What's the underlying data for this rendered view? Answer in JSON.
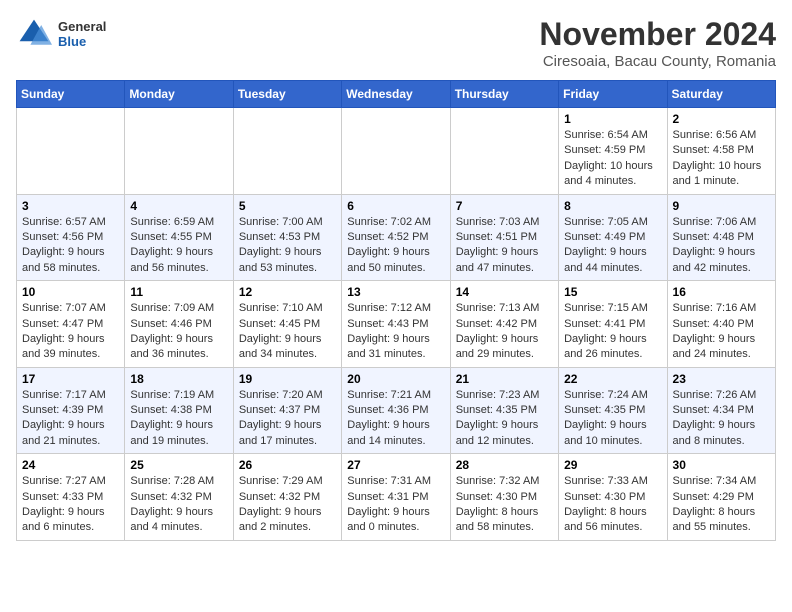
{
  "header": {
    "logo": {
      "general": "General",
      "blue": "Blue"
    },
    "title": "November 2024",
    "subtitle": "Ciresoaia, Bacau County, Romania"
  },
  "calendar": {
    "weekdays": [
      "Sunday",
      "Monday",
      "Tuesday",
      "Wednesday",
      "Thursday",
      "Friday",
      "Saturday"
    ],
    "weeks": [
      [
        {
          "day": "",
          "info": ""
        },
        {
          "day": "",
          "info": ""
        },
        {
          "day": "",
          "info": ""
        },
        {
          "day": "",
          "info": ""
        },
        {
          "day": "",
          "info": ""
        },
        {
          "day": "1",
          "info": "Sunrise: 6:54 AM\nSunset: 4:59 PM\nDaylight: 10 hours and 4 minutes."
        },
        {
          "day": "2",
          "info": "Sunrise: 6:56 AM\nSunset: 4:58 PM\nDaylight: 10 hours and 1 minute."
        }
      ],
      [
        {
          "day": "3",
          "info": "Sunrise: 6:57 AM\nSunset: 4:56 PM\nDaylight: 9 hours and 58 minutes."
        },
        {
          "day": "4",
          "info": "Sunrise: 6:59 AM\nSunset: 4:55 PM\nDaylight: 9 hours and 56 minutes."
        },
        {
          "day": "5",
          "info": "Sunrise: 7:00 AM\nSunset: 4:53 PM\nDaylight: 9 hours and 53 minutes."
        },
        {
          "day": "6",
          "info": "Sunrise: 7:02 AM\nSunset: 4:52 PM\nDaylight: 9 hours and 50 minutes."
        },
        {
          "day": "7",
          "info": "Sunrise: 7:03 AM\nSunset: 4:51 PM\nDaylight: 9 hours and 47 minutes."
        },
        {
          "day": "8",
          "info": "Sunrise: 7:05 AM\nSunset: 4:49 PM\nDaylight: 9 hours and 44 minutes."
        },
        {
          "day": "9",
          "info": "Sunrise: 7:06 AM\nSunset: 4:48 PM\nDaylight: 9 hours and 42 minutes."
        }
      ],
      [
        {
          "day": "10",
          "info": "Sunrise: 7:07 AM\nSunset: 4:47 PM\nDaylight: 9 hours and 39 minutes."
        },
        {
          "day": "11",
          "info": "Sunrise: 7:09 AM\nSunset: 4:46 PM\nDaylight: 9 hours and 36 minutes."
        },
        {
          "day": "12",
          "info": "Sunrise: 7:10 AM\nSunset: 4:45 PM\nDaylight: 9 hours and 34 minutes."
        },
        {
          "day": "13",
          "info": "Sunrise: 7:12 AM\nSunset: 4:43 PM\nDaylight: 9 hours and 31 minutes."
        },
        {
          "day": "14",
          "info": "Sunrise: 7:13 AM\nSunset: 4:42 PM\nDaylight: 9 hours and 29 minutes."
        },
        {
          "day": "15",
          "info": "Sunrise: 7:15 AM\nSunset: 4:41 PM\nDaylight: 9 hours and 26 minutes."
        },
        {
          "day": "16",
          "info": "Sunrise: 7:16 AM\nSunset: 4:40 PM\nDaylight: 9 hours and 24 minutes."
        }
      ],
      [
        {
          "day": "17",
          "info": "Sunrise: 7:17 AM\nSunset: 4:39 PM\nDaylight: 9 hours and 21 minutes."
        },
        {
          "day": "18",
          "info": "Sunrise: 7:19 AM\nSunset: 4:38 PM\nDaylight: 9 hours and 19 minutes."
        },
        {
          "day": "19",
          "info": "Sunrise: 7:20 AM\nSunset: 4:37 PM\nDaylight: 9 hours and 17 minutes."
        },
        {
          "day": "20",
          "info": "Sunrise: 7:21 AM\nSunset: 4:36 PM\nDaylight: 9 hours and 14 minutes."
        },
        {
          "day": "21",
          "info": "Sunrise: 7:23 AM\nSunset: 4:35 PM\nDaylight: 9 hours and 12 minutes."
        },
        {
          "day": "22",
          "info": "Sunrise: 7:24 AM\nSunset: 4:35 PM\nDaylight: 9 hours and 10 minutes."
        },
        {
          "day": "23",
          "info": "Sunrise: 7:26 AM\nSunset: 4:34 PM\nDaylight: 9 hours and 8 minutes."
        }
      ],
      [
        {
          "day": "24",
          "info": "Sunrise: 7:27 AM\nSunset: 4:33 PM\nDaylight: 9 hours and 6 minutes."
        },
        {
          "day": "25",
          "info": "Sunrise: 7:28 AM\nSunset: 4:32 PM\nDaylight: 9 hours and 4 minutes."
        },
        {
          "day": "26",
          "info": "Sunrise: 7:29 AM\nSunset: 4:32 PM\nDaylight: 9 hours and 2 minutes."
        },
        {
          "day": "27",
          "info": "Sunrise: 7:31 AM\nSunset: 4:31 PM\nDaylight: 9 hours and 0 minutes."
        },
        {
          "day": "28",
          "info": "Sunrise: 7:32 AM\nSunset: 4:30 PM\nDaylight: 8 hours and 58 minutes."
        },
        {
          "day": "29",
          "info": "Sunrise: 7:33 AM\nSunset: 4:30 PM\nDaylight: 8 hours and 56 minutes."
        },
        {
          "day": "30",
          "info": "Sunrise: 7:34 AM\nSunset: 4:29 PM\nDaylight: 8 hours and 55 minutes."
        }
      ]
    ]
  }
}
